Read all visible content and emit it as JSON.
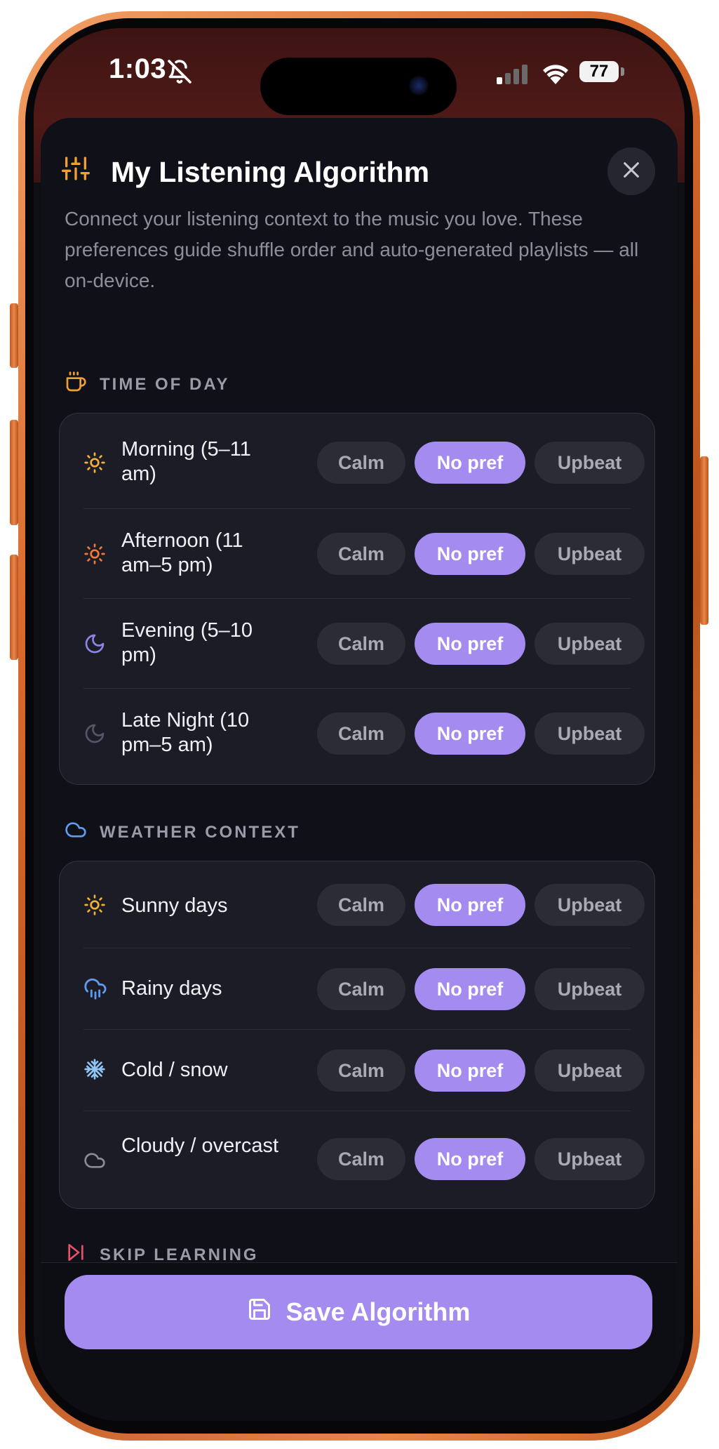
{
  "status_bar": {
    "time": "1:03",
    "battery": "77"
  },
  "header": {
    "title": "My Listening Algorithm",
    "description": "Connect your listening context to the music you love. These preferences guide shuffle order and auto-generated playlists — all on-device."
  },
  "sections": {
    "time_of_day": {
      "title": "TIME OF DAY",
      "rows": [
        {
          "label": "Morning (5–11 am)",
          "icon": "sun-icon",
          "selected": "No pref"
        },
        {
          "label": "Afternoon (11 am–5 pm)",
          "icon": "sun-icon",
          "selected": "No pref"
        },
        {
          "label": "Evening (5–10 pm)",
          "icon": "moon-icon",
          "selected": "No pref"
        },
        {
          "label": "Late Night (10 pm–5 am)",
          "icon": "moon-icon",
          "selected": "No pref"
        }
      ]
    },
    "weather": {
      "title": "WEATHER CONTEXT",
      "rows": [
        {
          "label": "Sunny days",
          "icon": "sun-icon",
          "selected": "No pref"
        },
        {
          "label": "Rainy days",
          "icon": "rain-cloud-icon",
          "selected": "No pref"
        },
        {
          "label": "Cold / snow",
          "icon": "snowflake-icon",
          "selected": "No pref"
        },
        {
          "label": "Cloudy / overcast",
          "icon": "cloud-icon",
          "selected": "No pref"
        }
      ]
    },
    "skip": {
      "title": "SKIP LEARNING"
    }
  },
  "options": {
    "calm": "Calm",
    "no_pref": "No pref",
    "upbeat": "Upbeat"
  },
  "footer": {
    "save_label": "Save Algorithm"
  },
  "colors": {
    "accent": "#a48bf0",
    "sheet_bg": "#101018",
    "card_bg": "#1c1c26",
    "frame_orange": "#d8692c"
  }
}
